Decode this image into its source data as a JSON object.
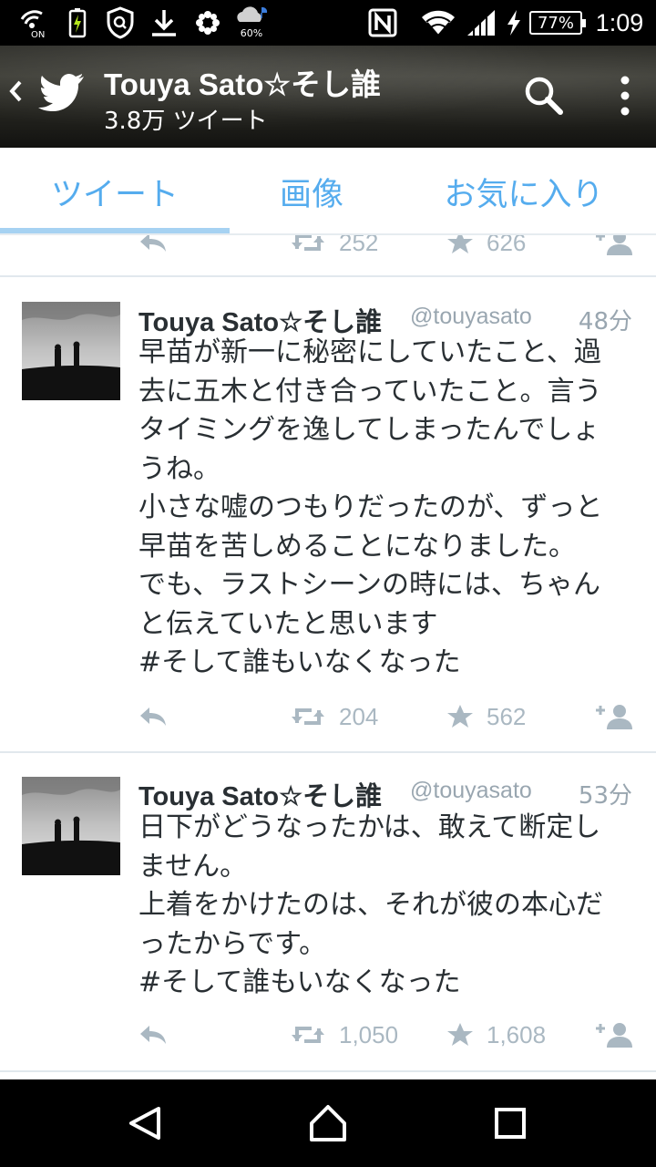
{
  "status_bar": {
    "weather_percent": "60%",
    "battery": "77%",
    "time": "1:09",
    "icons": [
      "wifi-calling-icon",
      "battery-saver-icon",
      "shield-icon",
      "download-icon",
      "flower-icon",
      "weather-icon",
      "nfc-icon",
      "wifi-icon",
      "signal-icon",
      "charging-icon"
    ]
  },
  "header": {
    "title": "Touya Sato☆そし誰",
    "subtitle": "3.8万 ツイート"
  },
  "tabs": [
    {
      "label": "ツイート",
      "active": true
    },
    {
      "label": "画像",
      "active": false
    },
    {
      "label": "お気に入り",
      "active": false
    }
  ],
  "partial_tweet": {
    "retweets": "252",
    "favorites": "626"
  },
  "tweets": [
    {
      "name": "Touya Sato☆そし誰",
      "handle": "@touyasato",
      "time": "48分",
      "lines": [
        "早苗が新一に秘密にしていたこと、過",
        "去に五木と付き合っていたこと。言う",
        "タイミングを逸してしまったんでしょ",
        "うね。",
        "小さな嘘のつもりだったのが、ずっと",
        "早苗を苦しめることになりました。",
        "でも、ラストシーンの時には、ちゃん",
        "と伝えていたと思います",
        "#そして誰もいなくなった"
      ],
      "retweets": "204",
      "favorites": "562"
    },
    {
      "name": "Touya Sato☆そし誰",
      "handle": "@touyasato",
      "time": "53分",
      "lines": [
        "日下がどうなったかは、敢えて断定し",
        "ません。",
        "上着をかけたのは、それが彼の本心だ",
        "ったからです。",
        "#そして誰もいなくなった"
      ],
      "retweets": "1,050",
      "favorites": "1,608"
    }
  ],
  "colors": {
    "accent": "#55acee",
    "indicator": "#a6d2f2",
    "icon_gray": "#aab8c2",
    "meta_gray": "#99a6b0"
  }
}
